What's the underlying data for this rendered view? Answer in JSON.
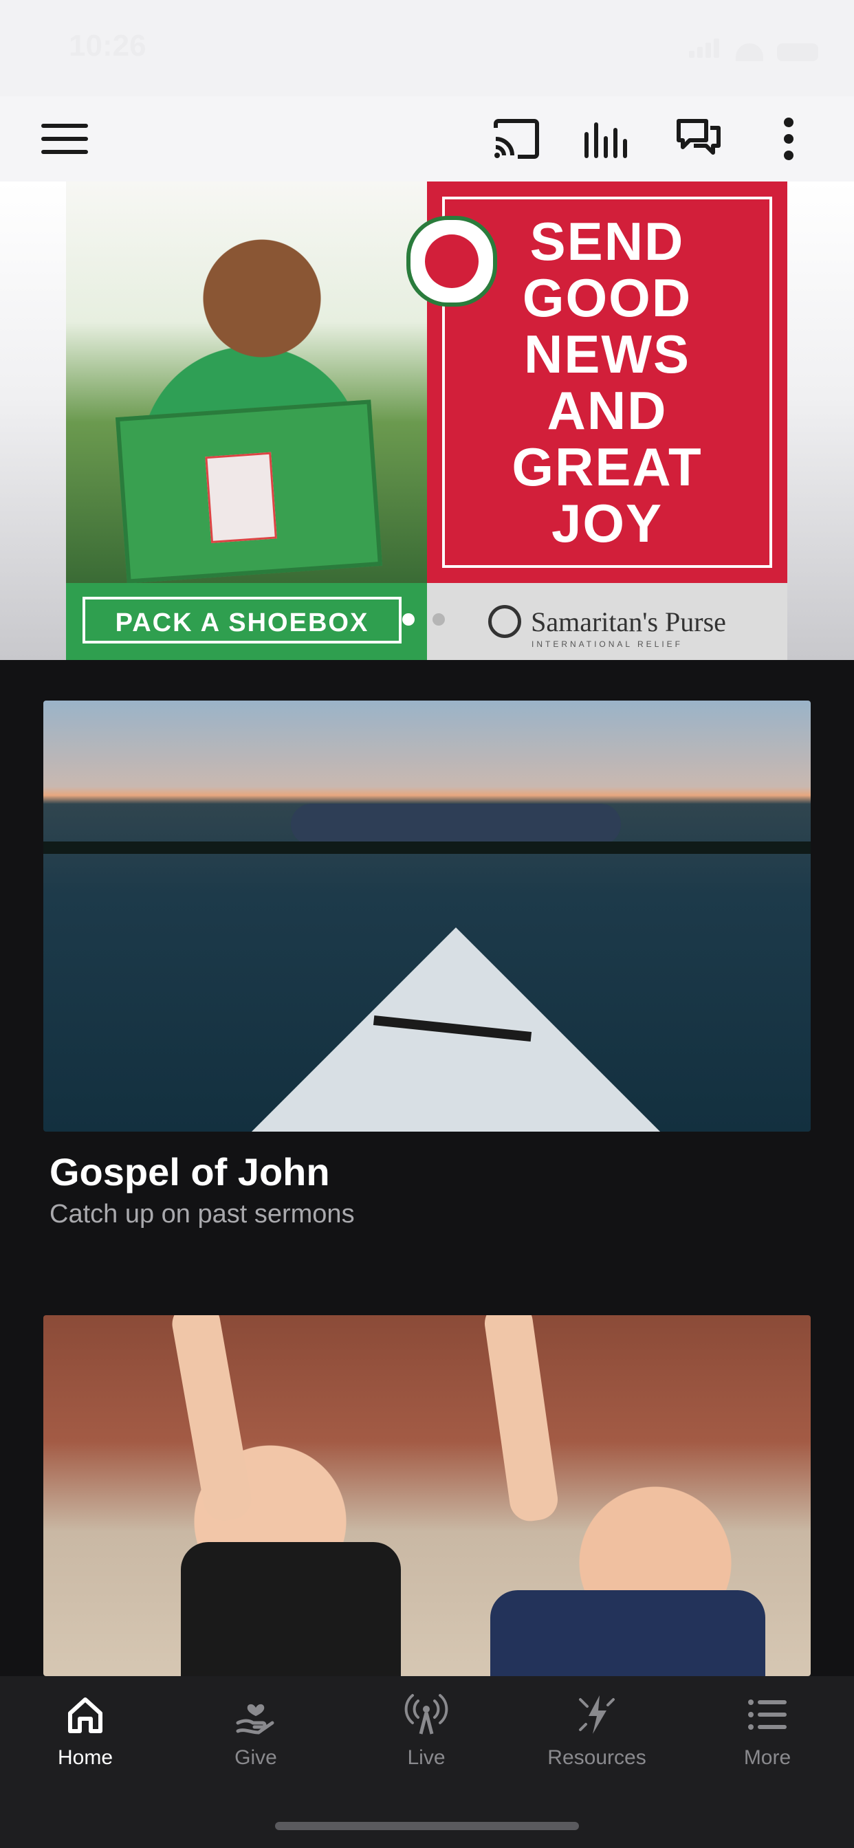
{
  "status_bar": {
    "time": "10:26"
  },
  "toolbar": {
    "icons": [
      "menu-icon",
      "cast-icon",
      "audio-icon",
      "chat-icon",
      "more-vertical-icon"
    ]
  },
  "banner": {
    "headline": "SEND\nGOOD\nNEWS\nAND\nGREAT\nJOY",
    "cta": "PACK A SHOEBOX",
    "brand": "Samaritan's Purse",
    "brand_sub": "INTERNATIONAL RELIEF",
    "slide_count": 2,
    "active_slide": 1,
    "colors": {
      "red": "#d21f3a",
      "green": "#2f9f4f"
    }
  },
  "cards": [
    {
      "title": "Gospel of John",
      "subtitle": "Catch up on past sermons"
    }
  ],
  "tabs": [
    {
      "label": "Home",
      "icon": "home-icon",
      "active": true
    },
    {
      "label": "Give",
      "icon": "give-icon",
      "active": false
    },
    {
      "label": "Live",
      "icon": "broadcast-icon",
      "active": false
    },
    {
      "label": "Resources",
      "icon": "resources-icon",
      "active": false
    },
    {
      "label": "More",
      "icon": "list-icon",
      "active": false
    }
  ]
}
